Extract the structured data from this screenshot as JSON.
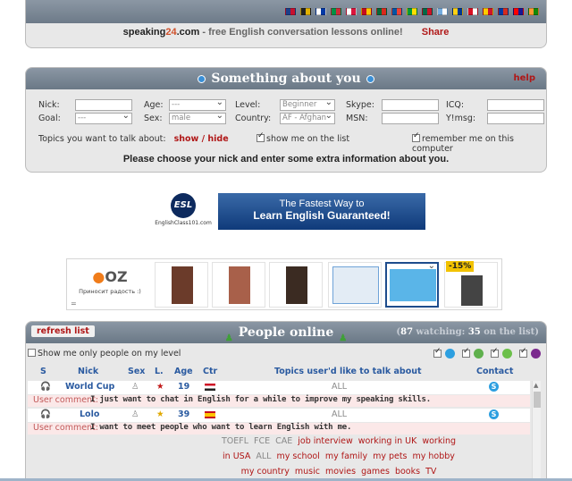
{
  "header": {
    "site_name_part1": "speaking",
    "site_name_part2": "24",
    "site_name_part3": ".com",
    "tagline": " - free English conversation lessons online!",
    "share_label": "Share",
    "flags": [
      {
        "name": "uk-flag-icon",
        "c1": "#1d3f8a",
        "c2": "#c8102e"
      },
      {
        "name": "germany-flag-icon",
        "c1": "#222",
        "c2": "#e2b100"
      },
      {
        "name": "russia-flag-icon",
        "c1": "#ffffff",
        "c2": "#0039a6"
      },
      {
        "name": "italy-flag-icon",
        "c1": "#009246",
        "c2": "#ce2b37"
      },
      {
        "name": "poland-flag-icon",
        "c1": "#ffffff",
        "c2": "#dc143c"
      },
      {
        "name": "spain-flag-icon",
        "c1": "#c60b1e",
        "c2": "#ffc400"
      },
      {
        "name": "portugal-flag-icon",
        "c1": "#046a38",
        "c2": "#da291c"
      },
      {
        "name": "france-flag-icon",
        "c1": "#0055a4",
        "c2": "#ef4135"
      },
      {
        "name": "brazil-flag-icon",
        "c1": "#009b3a",
        "c2": "#fedf00"
      },
      {
        "name": "mexico-flag-icon",
        "c1": "#006847",
        "c2": "#ce1126"
      },
      {
        "name": "argentina-flag-icon",
        "c1": "#74acdf",
        "c2": "#ffffff"
      },
      {
        "name": "colombia-flag-icon",
        "c1": "#fcd116",
        "c2": "#003893"
      },
      {
        "name": "peru-flag-icon",
        "c1": "#d91023",
        "c2": "#ffffff"
      },
      {
        "name": "venezuela-flag-icon",
        "c1": "#ffcc00",
        "c2": "#cf142b"
      },
      {
        "name": "chile-flag-icon",
        "c1": "#0039a6",
        "c2": "#d52b1e"
      },
      {
        "name": "croatia-flag-icon",
        "c1": "#ff0000",
        "c2": "#171796"
      },
      {
        "name": "india-flag-icon",
        "c1": "#ff9933",
        "c2": "#138808"
      }
    ]
  },
  "about": {
    "title": "Something about you",
    "help_label": "help",
    "nick_label": "Nick:",
    "age_label": "Age:",
    "age_value": "---",
    "level_label": "Level:",
    "level_value": "Beginner",
    "skype_label": "Skype:",
    "icq_label": "ICQ:",
    "goal_label": "Goal:",
    "goal_value": "---",
    "sex_label": "Sex:",
    "sex_value": "male",
    "country_label": "Country:",
    "country_value": "AF - Afghan",
    "msn_label": "MSN:",
    "ymsg_label": "Y!msg:",
    "topics_label": "Topics you want to talk about:",
    "show_hide": "show / hide",
    "show_on_list": "show me on the list",
    "remember_me": "remember me on this computer",
    "instruction": "Please choose your nick and enter some extra information about you."
  },
  "banners": {
    "esl_logo_text": "ESL",
    "esl_site": "EnglishClass101.com",
    "esl_line1": "The Fastest Way to",
    "esl_line2": "Learn English Guaranteed!",
    "oz_logo_a": "●",
    "oz_logo_b": "OZ",
    "oz_text": "Приносит радость :)",
    "oz_eq": "=",
    "discount": "-15%"
  },
  "people": {
    "refresh": "refresh list",
    "title": "People online",
    "watching_count": "87",
    "watching_text": "watching:",
    "on_list_count": "35",
    "on_list_text": "on the list",
    "level_filter": "Show me only people on my level",
    "columns": {
      "s": "S",
      "nick": "Nick",
      "sex": "Sex",
      "l": "L.",
      "age": "Age",
      "ctr": "Ctr",
      "topics": "Topics user'd like to talk about",
      "contact": "Contact"
    },
    "rows": [
      {
        "nick": "World Cup",
        "age": "19",
        "topics": "ALL",
        "comment_label": "User comment:",
        "comment": "I just want to chat in English for a while to improve my speaking skills.",
        "flag_c1": "#ce1126",
        "flag_c2": "#222"
      },
      {
        "nick": "Lolo",
        "age": "39",
        "topics": "ALL",
        "comment_label": "User comment:",
        "comment": "I want to meet people who want to learn English with me.",
        "flag_c1": "#c60b1e",
        "flag_c2": "#ffc400"
      }
    ],
    "tags_line1": [
      "TOEFL",
      "FCE",
      "CAE",
      "job interview",
      "working in UK",
      "working"
    ],
    "tags_line2": [
      "in USA",
      "ALL",
      "my school",
      "my family",
      "my pets",
      "my hobby"
    ],
    "tags_line3": [
      "my country",
      "music",
      "movies",
      "games",
      "books",
      "TV"
    ]
  }
}
